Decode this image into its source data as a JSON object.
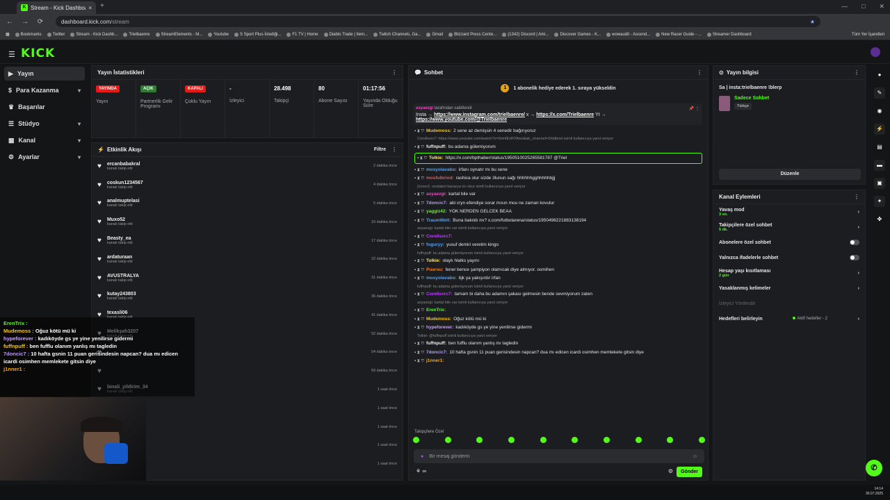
{
  "browser": {
    "tab_title": "Stream - Kick Dashboard",
    "url_host": "dashboard.kick.com",
    "url_path": "/stream",
    "bookmarks": [
      "Bookmarks",
      "Twitter",
      "Stream - Kick Dashb...",
      "Trielbaenre",
      "StreamElements - M...",
      "Youtube",
      "S Sport Plus-İstediği...",
      "F1 TV | Home",
      "Diablo Trade | Item...",
      "Twitch Channels, Ga...",
      "Gmail",
      "Blizzard Press Cente...",
      "(1342) Discord | Arki...",
      "Discover Games - K...",
      "wowaudit - Ascend...",
      "New Racer Guide - ...",
      "Streamer Dashboard"
    ],
    "all_bookmarks": "Tüm Yer İşaretleri"
  },
  "brand": "KICK",
  "sidebar": {
    "items": [
      {
        "label": "Yayın"
      },
      {
        "label": "Para Kazanma"
      },
      {
        "label": "Başarılar"
      },
      {
        "label": "Stüdyo"
      },
      {
        "label": "Kanal"
      },
      {
        "label": "Ayarlar"
      }
    ]
  },
  "stats": {
    "title": "Yayın İstatistikleri",
    "items": [
      {
        "badge": "YAYINDA",
        "badge_color": "#e91916",
        "label": "Yayın"
      },
      {
        "badge": "AÇIK",
        "badge_color": "#2e7d32",
        "label": "Partnerlik Gelir Programı"
      },
      {
        "badge": "KAPALI",
        "badge_color": "#e91916",
        "label": "Çoklu Yayın"
      },
      {
        "value": "-",
        "label": "İzleyici"
      },
      {
        "value": "28.498",
        "label": "Takipçi"
      },
      {
        "value": "80",
        "label": "Abone Sayısı"
      },
      {
        "value": "01:17:56",
        "label": "Yayında Olduğu Süre"
      }
    ]
  },
  "activity": {
    "title": "Etkinlik Akışı",
    "filter": "Filtre",
    "rows": [
      {
        "name": "ercanbabakral",
        "sub": "kanalı takip etti",
        "time": "2 dakika önce"
      },
      {
        "name": "coskun1234567",
        "sub": "kanalı takip etti",
        "time": "4 dakika önce"
      },
      {
        "name": "analmuptelasi",
        "sub": "kanalı takip etti",
        "time": "5 dakika önce"
      },
      {
        "name": "Muxo52",
        "sub": "kanalı takip etti",
        "time": "10 dakika önce"
      },
      {
        "name": "Beasty_ea",
        "sub": "kanalı takip etti",
        "time": "17 dakika önce"
      },
      {
        "name": "ardaturaan",
        "sub": "kanalı takip etti",
        "time": "22 dakika önce"
      },
      {
        "name": "AVUSTRALYA",
        "sub": "kanalı takip etti",
        "time": "31 dakika önce"
      },
      {
        "name": "kutay243803",
        "sub": "kanalı takip etti",
        "time": "35 dakika önce"
      },
      {
        "name": "texasli06",
        "sub": "kanalı takip etti",
        "time": "41 dakika önce"
      },
      {
        "name": "Melikşah3207",
        "sub": "kanalı takip etti",
        "time": "52 dakika önce"
      },
      {
        "name": "",
        "sub": "",
        "time": "54 dakika önce"
      },
      {
        "name": "",
        "sub": "",
        "time": "59 dakika önce"
      },
      {
        "name": "binali_yildirim_34",
        "sub": "kanalı takip etti",
        "time": "1 saat önce"
      },
      {
        "name": "",
        "sub": "",
        "time": "1 saat önce"
      },
      {
        "name": "",
        "sub": "",
        "time": "1 saat önce"
      },
      {
        "name": "",
        "sub": "",
        "time": "1 saat önce"
      },
      {
        "name": "",
        "sub": "",
        "time": "1 saat önce"
      }
    ]
  },
  "chat": {
    "title": "Sohbet",
    "sub_banner": "1 abonelik hediye ederek 1. sıraya yükseldin",
    "pinned_by": "asyaezgi",
    "pinned_suffix": "tarafından sabitlendi",
    "pinned_l1a": "Insta →",
    "pinned_l1b": "https://www.instagram.com/trielbaenre/",
    "pinned_l1c": "x →",
    "pinned_l1d": "https://x.com/Trielbaenre",
    "pinned_l1e": "Yt →",
    "pinned_l2": "https://www.youtube.com/@Trielbaenre",
    "messages": [
      {
        "user": "Mudemoss",
        "color": "#f5c518",
        "text": "2 sene az demişsin 4 senedir bağırıyoruz"
      },
      {
        "reply": "Corellsxrc7: https://www.youtube.com/watch?v=0vmfExRYAwo&ab_channel=Shldbost isimli kullanıcıya yanıt veriyor"
      },
      {
        "user": "fuffnpuff",
        "color": "#eeeeee",
        "text": "bu adama gülemiyorum"
      },
      {
        "user": "Tolkie",
        "color": "#ffe66d",
        "text": "https://x.com/bpthaber/status/1950510025265581787 @Triel",
        "hl": true
      },
      {
        "user": "mosyolavabo",
        "color": "#4aa3ff",
        "text": "irfanı oynatır mı bu sene"
      },
      {
        "user": "mosfulbriod",
        "color": "#ff4d4d",
        "text": "rashica olur sizde 3lunun sağı hhhhhhgghhhhhbjjj"
      },
      {
        "reply": "j1nner1: sostakot kanarya mı okur isimli kullanıcıya yanıt veriyor"
      },
      {
        "user": "asyaezgi",
        "color": "#e24fbd",
        "text": "kartal bile var"
      },
      {
        "user": "7doncic7",
        "color": "#b9f",
        "text": "abi cryn efendiye sorar mısın mou ne zaman kovulur"
      },
      {
        "user": "yaggiz42",
        "color": "#53fc18",
        "text": "YOK NERDEN GELCEK BEAA"
      },
      {
        "user": "TraumWelt",
        "color": "#4aa3ff",
        "text": "Buna bakıldı mı? x.com/futbolarena/status/1950498221883138194"
      },
      {
        "reply": "asyaezgi: kartal bile var isimli kullanıcıya yanıt veriyor"
      },
      {
        "user": "Corellsxrc7",
        "color": "#c03cff",
        "text": ""
      },
      {
        "user": "fuguryy",
        "color": "#4aa3ff",
        "text": "yusuf demiri verelim kingo"
      },
      {
        "reply": "fuffnpuff: bu adama gülemiyorum isimli kullanıcıya yanıt veriyor"
      },
      {
        "user": "Tolkie",
        "color": "#ffe66d",
        "text": "olaylı hlalks yayını"
      },
      {
        "user": "Puarou",
        "color": "#ff7b00",
        "text": "fener bence şampiyon olamıcak diye almıyor. osmihen"
      },
      {
        "user": "mosyolavabo",
        "color": "#4aa3ff",
        "text": "bjk ya yakışırdır irfan"
      },
      {
        "reply": "fuffnpuff: bu adama gülemiyorum isimli kullanıcıya yanıt veriyor"
      },
      {
        "user": "Corellsxrc7",
        "color": "#c03cff",
        "text": "tamam bi daha bu adamın şakası gelmesin bende sevmiyorum zaten"
      },
      {
        "reply": "asyaezgi: kartal bile var isimli kullanıcıya yanıt veriyor"
      },
      {
        "user": "ErenTrix",
        "color": "#53fc18",
        "text": ""
      },
      {
        "user": "Mudemoss",
        "color": "#f5c518",
        "text": "Oğuz kötü mü ki"
      },
      {
        "user": "hypeforever",
        "color": "#c9a0ff",
        "text": "kadıköyde gs ye yine yenilirse gidermi"
      },
      {
        "reply": "Tolkie: @fuffnpuff isimli kullanıcıya yanıt veriyor"
      },
      {
        "user": "fuffnpuff",
        "color": "#eeeeee",
        "text": "ben fufflu olanım yanlış mı tagledin"
      },
      {
        "user": "7doncic7",
        "color": "#b9f",
        "text": "10 hafta gsnin 11 puan gerisindesin napcan? dua mı edicen icardi osimhen memlekete gitsin diye"
      },
      {
        "user": "j1nner1",
        "color": "#ffa500",
        "text": ""
      }
    ],
    "followers_label": "Takipçilere Özel",
    "placeholder": "Bir mesaj gönderin",
    "send": "Gönder"
  },
  "info": {
    "title": "Yayın bilgisi",
    "stream_title": "Sa | insta:trielbaenre !blerp",
    "category": "Sadece Sohbet",
    "language": "Türkçe",
    "edit": "Düzenle"
  },
  "actions": {
    "title": "Kanal Eylemleri",
    "items": [
      {
        "label": "Yavaş mod",
        "sub": "3 sn.",
        "type": "arrow"
      },
      {
        "label": "Takipçilere özel sohbet",
        "sub": "5 dk.",
        "type": "arrow"
      },
      {
        "label": "Abonelere özel sohbet",
        "sub": "",
        "type": "toggle"
      },
      {
        "label": "Yalnızca ifadelerle sohbet",
        "sub": "",
        "type": "toggle"
      },
      {
        "label": "Hesap yaşı kısıtlaması",
        "sub": "2 gün",
        "type": "arrow"
      },
      {
        "label": "Yasaklanmış kelimeler",
        "sub": "",
        "type": "arrow"
      },
      {
        "label": "İzleyici Yönlendir",
        "sub": "",
        "type": "disabled"
      },
      {
        "label": "Hedefleri belirleyin",
        "sub": "",
        "type": "goals",
        "extra": "Aktif hedefler - 2"
      }
    ]
  },
  "overlay": [
    {
      "user": "ErenTrix",
      "color": "#53fc18",
      "text": ""
    },
    {
      "user": "Mudemoss",
      "color": "#f5c518",
      "text": "Oğuz kötü mü ki"
    },
    {
      "user": "hypeforever",
      "color": "#c9a0ff",
      "text": "kadıköyde gs ye yine yenilirse gidermi"
    },
    {
      "user": "fuffnpuff",
      "color": "#f5c518",
      "text": "ben fufflu olanım yanlış mı tagledin"
    },
    {
      "user": "7doncic7",
      "color": "#b9f",
      "text": "10 hafta gsnin 11 puan gerisindesin napcan? dua mı edicen icardi osimhen memlekete gitsin diye"
    },
    {
      "user": "j1nner1",
      "color": "#ffa500",
      "text": ""
    }
  ],
  "clock": {
    "time": "14:14",
    "date": "30.07.2025"
  }
}
